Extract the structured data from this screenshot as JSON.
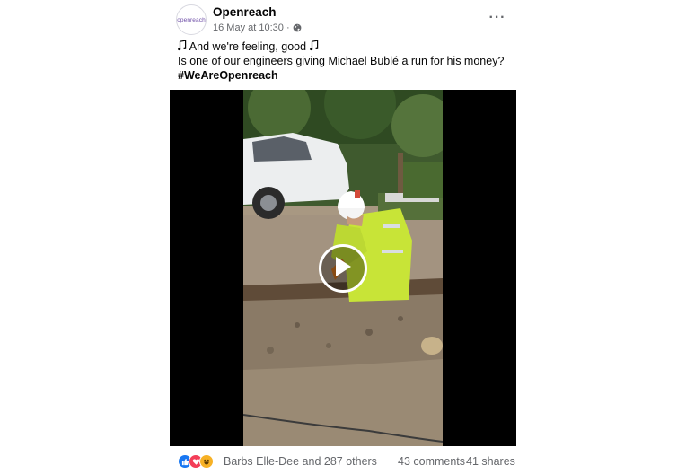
{
  "post": {
    "page_name": "Openreach",
    "avatar_text": "openreach",
    "timestamp": "16 May at 10:30 ·",
    "line1": "And we're feeling, good",
    "line2": "Is one of our engineers giving Michael Bublé a run for his money?",
    "hashtag": "#WeAreOpenreach",
    "more_icon": "···"
  },
  "icons": {
    "globe": "globe-icon",
    "note": "music-note-icon",
    "more": "more-options-icon",
    "play": "play-icon"
  },
  "footer": {
    "reaction_names": "Barbs Elle-Dee and 287 others",
    "comments": "43 comments",
    "shares": "41 shares"
  },
  "colors": {
    "like": "#1877f2",
    "love": "#f33e58",
    "haha": "#f7b125",
    "secondary_text": "#65676b",
    "brand": "#6b4aa5"
  }
}
